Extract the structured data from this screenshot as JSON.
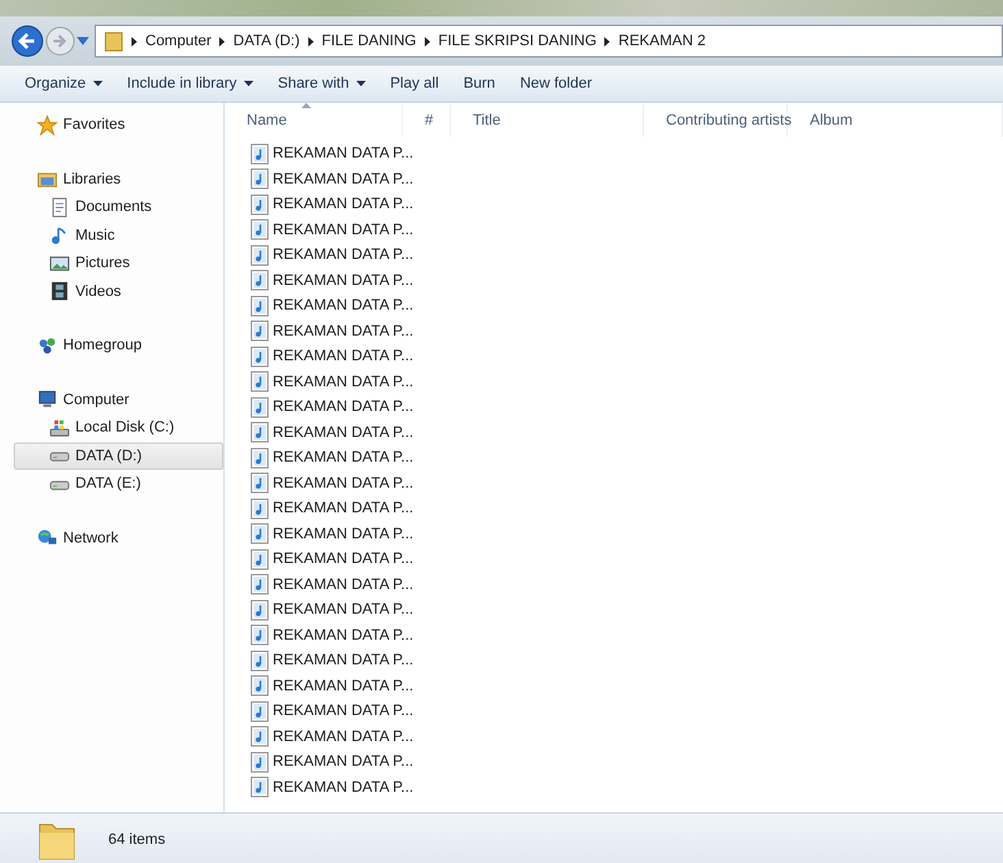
{
  "address_bar": {
    "path": [
      "Computer",
      "DATA (D:)",
      "FILE DANING",
      "FILE SKRIPSI DANING",
      "REKAMAN 2"
    ]
  },
  "toolbar": [
    {
      "label": "Organize",
      "dropdown": true
    },
    {
      "label": "Include in library",
      "dropdown": true
    },
    {
      "label": "Share with",
      "dropdown": true
    },
    {
      "label": "Play all",
      "dropdown": false
    },
    {
      "label": "Burn",
      "dropdown": false
    },
    {
      "label": "New folder",
      "dropdown": false
    }
  ],
  "sidebar": {
    "items": [
      {
        "label": "Favorites",
        "kind": "star",
        "selected": false
      },
      {
        "label": "Libraries",
        "kind": "library",
        "selected": false,
        "children": [
          {
            "label": "Documents",
            "kind": "document",
            "selected": false
          },
          {
            "label": "Music",
            "kind": "music",
            "selected": false
          },
          {
            "label": "Pictures",
            "kind": "pictures",
            "selected": false
          },
          {
            "label": "Videos",
            "kind": "video",
            "selected": false
          }
        ]
      },
      {
        "label": "Homegroup",
        "kind": "homegroup",
        "selected": false
      },
      {
        "label": "Computer",
        "kind": "computer",
        "selected": false,
        "children": [
          {
            "label": "Local Disk (C:)",
            "kind": "system-disk",
            "selected": false
          },
          {
            "label": "DATA (D:)",
            "kind": "drive",
            "selected": true
          },
          {
            "label": "DATA (E:)",
            "kind": "drive",
            "selected": false
          }
        ]
      },
      {
        "label": "Network",
        "kind": "network",
        "selected": false
      }
    ]
  },
  "table": {
    "columns": [
      "Name",
      "#",
      "Title",
      "Contributing artists",
      "Album"
    ],
    "rows": [
      "REKAMAN DATA P...",
      "REKAMAN DATA P...",
      "REKAMAN DATA P...",
      "REKAMAN DATA P...",
      "REKAMAN DATA P...",
      "REKAMAN DATA P...",
      "REKAMAN DATA P...",
      "REKAMAN DATA P...",
      "REKAMAN DATA P...",
      "REKAMAN DATA P...",
      "REKAMAN DATA P...",
      "REKAMAN DATA P...",
      "REKAMAN DATA P...",
      "REKAMAN DATA P...",
      "REKAMAN DATA P...",
      "REKAMAN DATA P...",
      "REKAMAN DATA P...",
      "REKAMAN DATA P...",
      "REKAMAN DATA P...",
      "REKAMAN DATA P...",
      "REKAMAN DATA P...",
      "REKAMAN DATA P...",
      "REKAMAN DATA P...",
      "REKAMAN DATA P...",
      "REKAMAN DATA P...",
      "REKAMAN DATA P..."
    ]
  },
  "status_bar": {
    "text": "64 items"
  }
}
